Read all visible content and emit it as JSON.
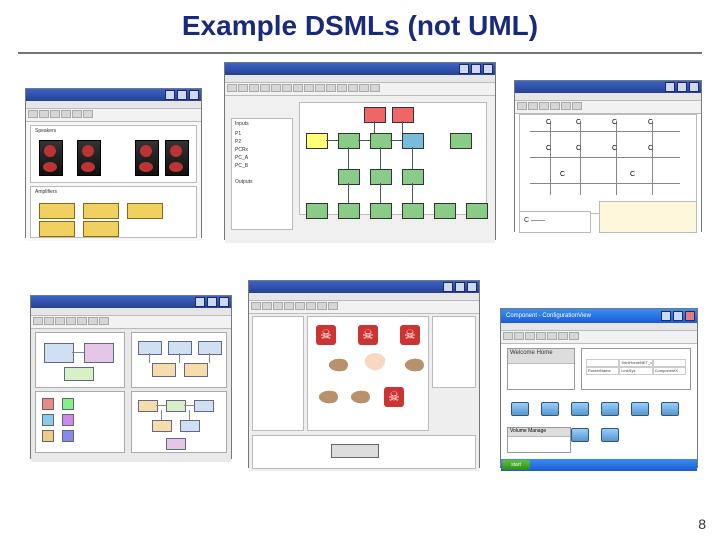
{
  "title": "Example DSMLs (not UML)",
  "page_number": "8",
  "screenshots": {
    "s1": {
      "rows": [
        "Speakers",
        "Amplifiers"
      ]
    },
    "s2": {
      "sidebar_lines": [
        "Inputs",
        "P1",
        "P2",
        "PCRx",
        "PC_A",
        "PC_B",
        "Outputs"
      ]
    },
    "s3": {
      "symbol": "C",
      "legend_label": "C ——"
    },
    "s4": {},
    "s5": {},
    "s6": {
      "title": "Component - ConfigurationView",
      "welcome": "Welcome Home",
      "volume": "Volume Manage",
      "start": "start",
      "config_rows": [
        [
          "",
          "SriniHomeNET_v5",
          ""
        ],
        [
          "RouterName",
          "LinkSys",
          "ComponentX"
        ]
      ]
    }
  }
}
